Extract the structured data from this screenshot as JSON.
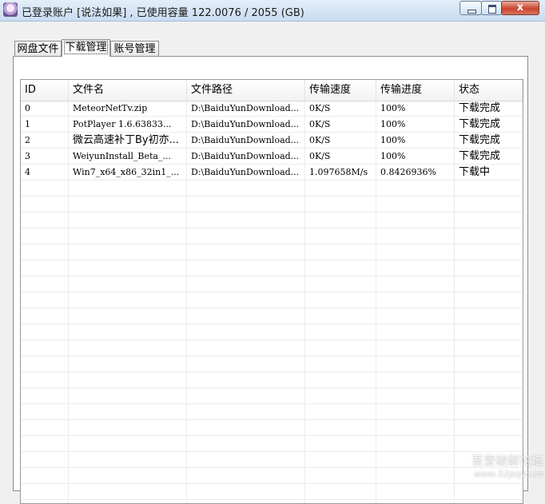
{
  "window": {
    "title": "已登录账户 [说法如果] , 已使用容量 122.0076 / 2055 (GB)",
    "minimize_glyph": "",
    "maximize_glyph": "",
    "close_glyph": "x"
  },
  "tabs": [
    {
      "label": "网盘文件",
      "active": false
    },
    {
      "label": "下载管理",
      "active": true
    },
    {
      "label": "账号管理",
      "active": false
    }
  ],
  "table": {
    "columns": [
      "ID",
      "文件名",
      "文件路径",
      "传输速度",
      "传输进度",
      "状态"
    ],
    "rows": [
      [
        "0",
        "MeteorNetTv.zip",
        "D:\\BaiduYunDownload...",
        "0K/S",
        "100%",
        "下载完成"
      ],
      [
        "1",
        "PotPlayer 1.6.63833...",
        "D:\\BaiduYunDownload...",
        "0K/S",
        "100%",
        "下载完成"
      ],
      [
        "2",
        "微云高速补丁By初亦...",
        "D:\\BaiduYunDownload...",
        "0K/S",
        "100%",
        "下载完成"
      ],
      [
        "3",
        "WeiyunInstall_Beta_...",
        "D:\\BaiduYunDownload...",
        "0K/S",
        "100%",
        "下载完成"
      ],
      [
        "4",
        "Win7_x64_x86_32in1_...",
        "D:\\BaiduYunDownload...",
        "1.097658M/s",
        "0.8426936%",
        "下载中"
      ]
    ]
  },
  "watermark": {
    "line1": "吾爱破解论坛",
    "line2": "www.52pojie.cn"
  }
}
